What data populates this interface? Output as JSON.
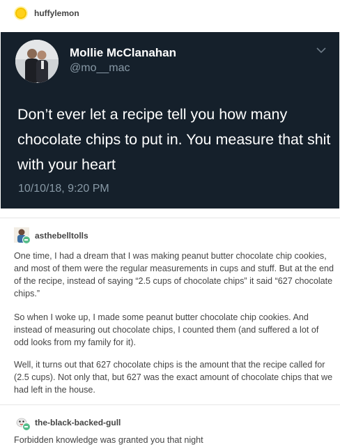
{
  "post_author": {
    "username": "huffylemon",
    "avatar_icon": "sun-icon"
  },
  "tweet": {
    "display_name": "Mollie McClanahan",
    "handle": "@mo__mac",
    "text": "Don’t ever let a recipe tell you how many chocolate chips to put in. You measure that shit with your heart",
    "timestamp": "10/10/18, 9:20 PM",
    "background": "#15202b"
  },
  "reblogs": [
    {
      "username": "asthebelltolls",
      "paragraphs": [
        "One time, I had a dream that I was making peanut butter chocolate chip cookies, and most of them were the regular measurements in cups and stuff. But at the end of the recipe, instead of saying “2.5 cups of chocolate chips” it said “627 chocolate chips.”",
        "So when I woke up, I made some peanut butter chocolate chip cookies. And instead of measuring out chocolate chips, I counted them (and suffered a lot of odd looks from my family for it).",
        "Well, it turns out that 627 chocolate chips is the amount that the recipe called for (2.5 cups). Not only that, but 627 was the exact amount of chocolate chips that we had left in the house."
      ]
    },
    {
      "username": "the-black-backed-gull",
      "paragraphs": [
        "Forbidden knowledge was granted you that night"
      ]
    }
  ]
}
